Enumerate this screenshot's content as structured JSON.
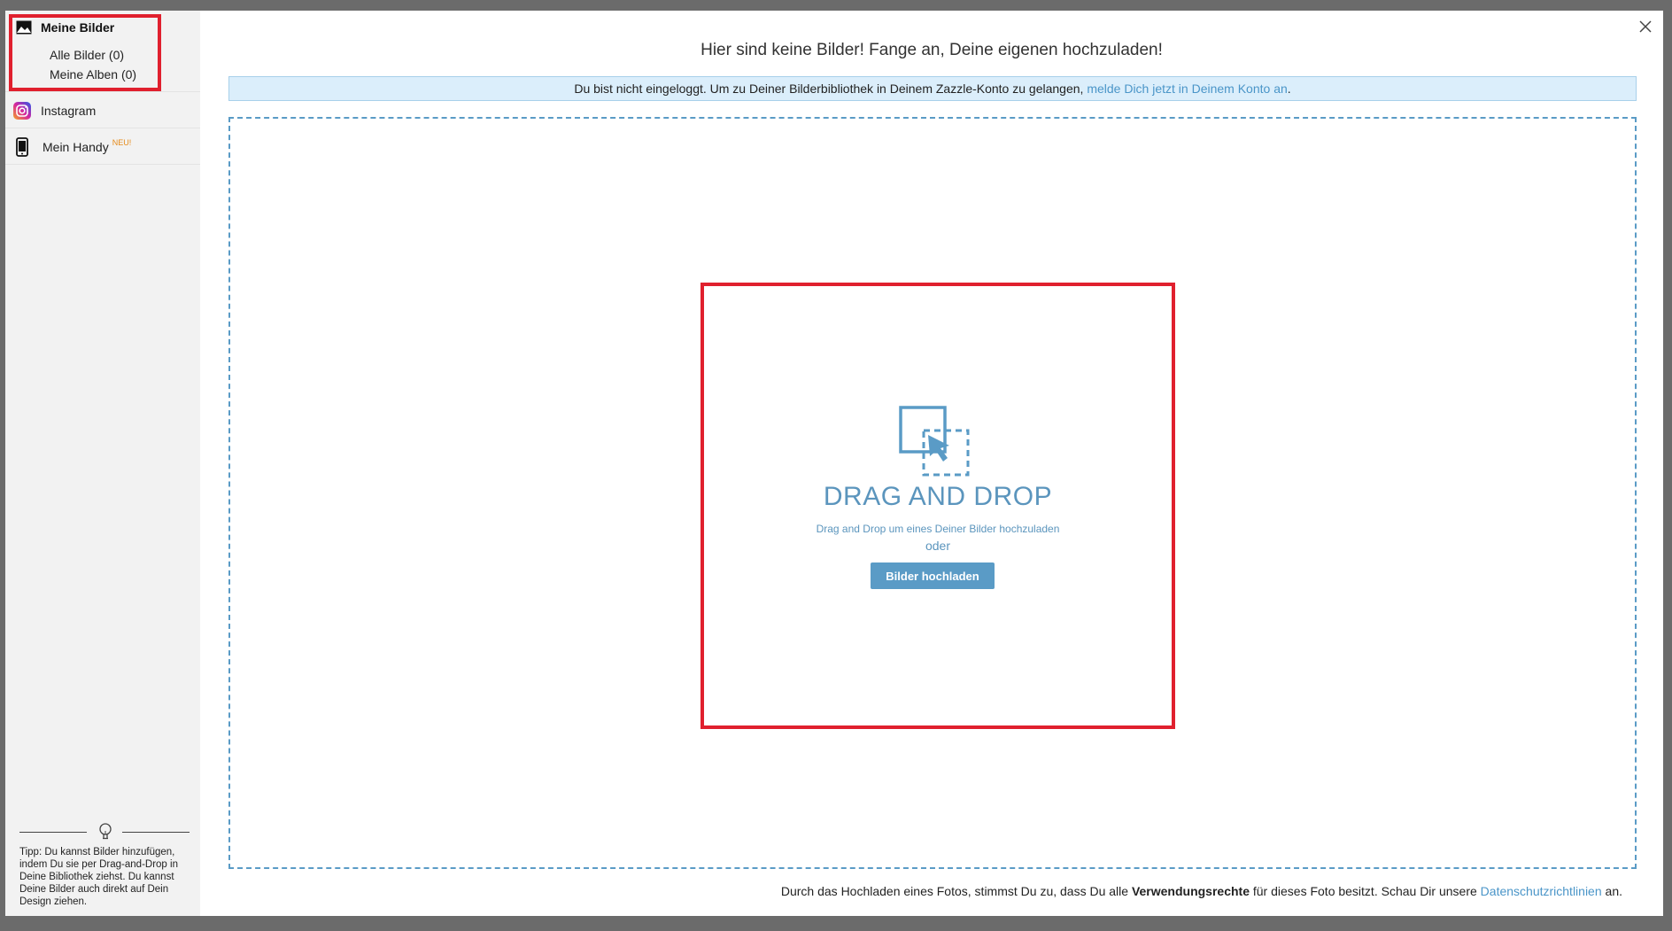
{
  "sidebar": {
    "my_images": {
      "label": "Meine Bilder",
      "icon": "image-icon",
      "sub_items": [
        {
          "label": "Alle Bilder (0)"
        },
        {
          "label": "Meine Alben (0)"
        }
      ]
    },
    "instagram": {
      "label": "Instagram",
      "icon": "instagram-icon"
    },
    "my_phone": {
      "label": "Mein Handy",
      "badge": "NEU!",
      "icon": "phone-icon"
    },
    "tip": "Tipp: Du kannst Bilder hinzufügen, indem Du sie per Drag-and-Drop in Deine Bibliothek ziehst. Du kannst Deine Bilder auch direkt auf Dein Design ziehen."
  },
  "main": {
    "title": "Hier sind keine Bilder! Fange an, Deine eigenen hochzuladen!",
    "info_text": "Du bist nicht eingeloggt. Um zu Deiner Bilderbibliothek in Deinem Zazzle-Konto zu gelangen, ",
    "info_link": "melde Dich jetzt in Deinem Konto an",
    "info_end": ".",
    "dropzone": {
      "title": "DRAG AND DROP",
      "subtitle": "Drag and Drop um eines Deiner Bilder hochzuladen",
      "or": "oder",
      "button": "Bilder hochladen"
    },
    "footer": {
      "part1": "Durch das Hochladen eines Fotos, stimmst Du zu, dass Du alle ",
      "bold": "Verwendungsrechte",
      "part2": " für dieses Foto besitzt. Schau Dir unsere ",
      "link": "Datenschutzrichtlinien",
      "part3": " an."
    }
  },
  "colors": {
    "accent": "#5a9bc6",
    "highlight": "#e0202e",
    "info_bg": "#dbeefb",
    "badge": "#e58a1a"
  }
}
